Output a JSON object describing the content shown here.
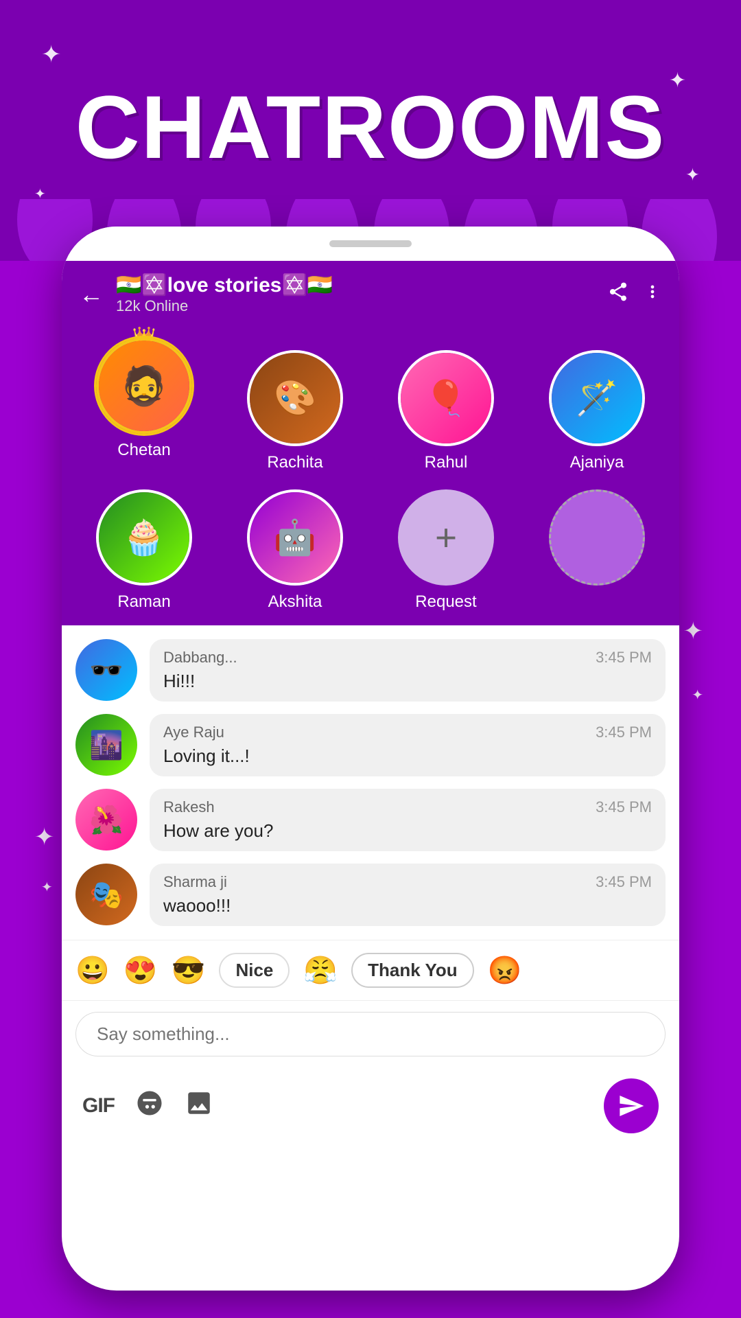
{
  "app": {
    "title": "CHATROOMS"
  },
  "header": {
    "room_name": "🇮🇳✡️love stories✡️🇮🇳",
    "online_count": "12k Online",
    "back_label": "←",
    "share_icon": "share",
    "more_icon": "more"
  },
  "participants": [
    {
      "name": "Chetan",
      "has_crown": true,
      "avatar_color": "av1"
    },
    {
      "name": "Rachita",
      "has_crown": false,
      "avatar_color": "av2"
    },
    {
      "name": "Rahul",
      "has_crown": false,
      "avatar_color": "av3"
    },
    {
      "name": "Ajaniya",
      "has_crown": false,
      "avatar_color": "av4"
    },
    {
      "name": "Raman",
      "has_crown": false,
      "avatar_color": "av5"
    },
    {
      "name": "Akshita",
      "has_crown": false,
      "avatar_color": "av6"
    },
    {
      "name": "Request",
      "is_add": true
    },
    {
      "name": "",
      "is_empty": true
    }
  ],
  "messages": [
    {
      "username": "Dabbang...",
      "time": "3:45 PM",
      "text": "Hi!!!",
      "avatar_color": "av4"
    },
    {
      "username": "Aye Raju",
      "time": "3:45 PM",
      "text": "Loving it...!",
      "avatar_color": "av5"
    },
    {
      "username": "Rakesh",
      "time": "3:45 PM",
      "text": "How are you?",
      "avatar_color": "av3"
    },
    {
      "username": "Sharma ji",
      "time": "3:45 PM",
      "text": "waooo!!!",
      "avatar_color": "av2"
    }
  ],
  "reactions": [
    {
      "type": "emoji",
      "value": "😀"
    },
    {
      "type": "emoji",
      "value": "😍"
    },
    {
      "type": "emoji",
      "value": "😎"
    },
    {
      "type": "pill",
      "value": "Nice"
    },
    {
      "type": "emoji",
      "value": "😤"
    },
    {
      "type": "pill",
      "value": "Thank You"
    },
    {
      "type": "emoji",
      "value": "😡"
    }
  ],
  "input": {
    "placeholder": "Say something..."
  },
  "toolbar": {
    "gif_label": "GIF",
    "emoji_icon": "😊",
    "image_icon": "🖼️"
  }
}
